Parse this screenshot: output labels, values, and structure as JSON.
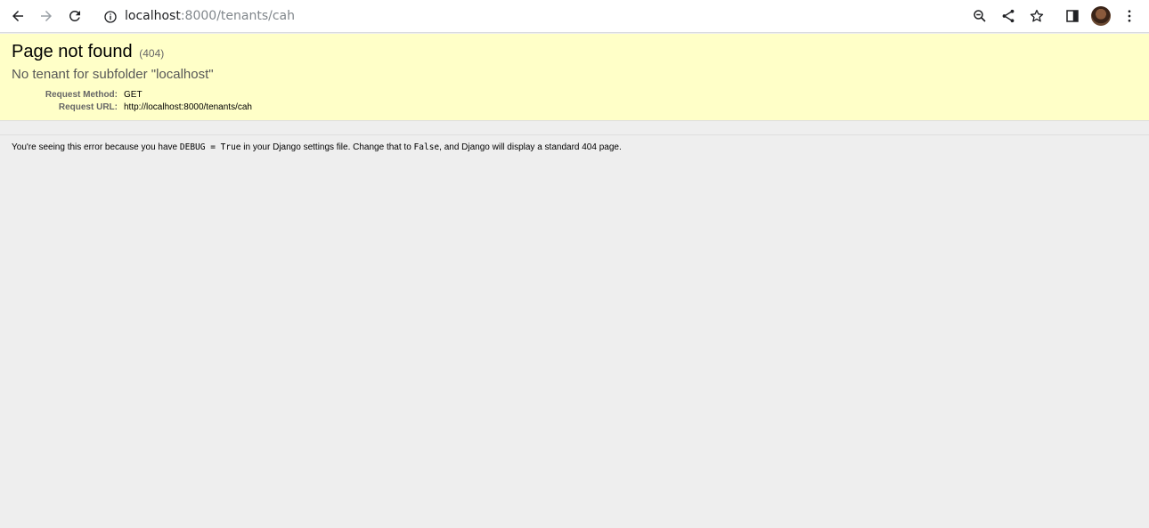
{
  "browser": {
    "url_host": "localhost",
    "url_path": ":8000/tenants/cah",
    "icons": {
      "back": "arrow-left-icon",
      "forward": "arrow-right-icon",
      "reload": "reload-icon",
      "site_info": "info-icon",
      "zoom": "zoom-out-icon",
      "share": "share-icon",
      "bookmark": "star-icon",
      "side_panel": "side-panel-icon",
      "profile": "avatar",
      "menu": "kebab-menu-icon"
    }
  },
  "summary": {
    "title": "Page not found",
    "status_code": "(404)",
    "message": "No tenant for subfolder \"localhost\"",
    "request_method_label": "Request Method:",
    "request_method_value": "GET",
    "request_url_label": "Request URL:",
    "request_url_value": "http://localhost:8000/tenants/cah",
    "background_color": "#ffffc8"
  },
  "explanation": {
    "part1": "You're seeing this error because you have ",
    "code1": "DEBUG = True",
    "part2": " in your Django settings file. Change that to ",
    "code2": "False",
    "part3": ", and Django will display a standard 404 page."
  }
}
